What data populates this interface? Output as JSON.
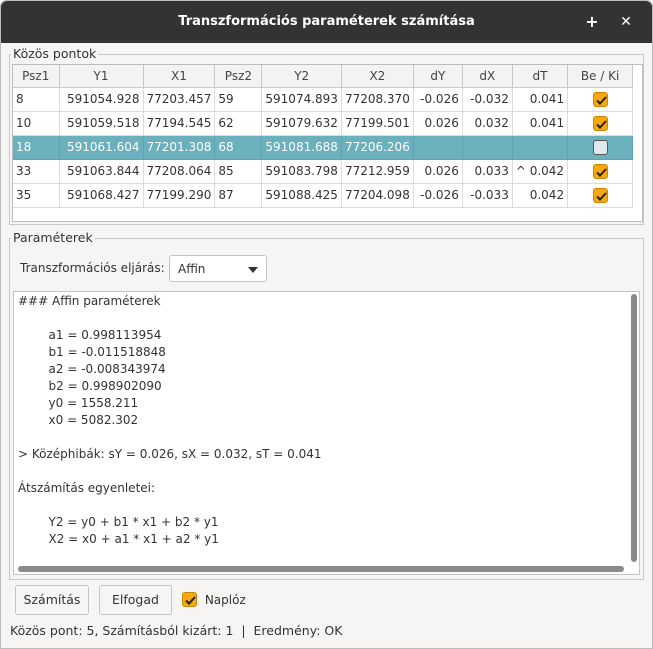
{
  "window": {
    "title": "Transzformációs paraméterek számítása",
    "plus_glyph": "+",
    "close_glyph": "✕"
  },
  "common_points": {
    "label": "Közös pontok",
    "columns": [
      "Psz1",
      "Y1",
      "X1",
      "Psz2",
      "Y2",
      "X2",
      "dY",
      "dX",
      "dT",
      "Be / Ki"
    ],
    "rows": [
      {
        "psz1": "8",
        "y1": "591054.928",
        "x1": "77203.457",
        "psz2": "59",
        "y2": "591074.893",
        "x2": "77208.370",
        "dy": "-0.026",
        "dx": "-0.032",
        "dt": "0.041",
        "enabled": true,
        "selected": false
      },
      {
        "psz1": "10",
        "y1": "591059.518",
        "x1": "77194.545",
        "psz2": "62",
        "y2": "591079.632",
        "x2": "77199.501",
        "dy": "0.026",
        "dx": "0.032",
        "dt": "0.041",
        "enabled": true,
        "selected": false
      },
      {
        "psz1": "18",
        "y1": "591061.604",
        "x1": "77201.308",
        "psz2": "68",
        "y2": "591081.688",
        "x2": "77206.206",
        "dy": "",
        "dx": "",
        "dt": "",
        "enabled": false,
        "selected": true
      },
      {
        "psz1": "33",
        "y1": "591063.844",
        "x1": "77208.064",
        "psz2": "85",
        "y2": "591083.798",
        "x2": "77212.959",
        "dy": "0.026",
        "dx": "0.033",
        "dt": "^ 0.042",
        "enabled": true,
        "selected": false
      },
      {
        "psz1": "35",
        "y1": "591068.427",
        "x1": "77199.290",
        "psz2": "87",
        "y2": "591088.425",
        "x2": "77204.098",
        "dy": "-0.026",
        "dx": "-0.033",
        "dt": "0.042",
        "enabled": true,
        "selected": false
      }
    ]
  },
  "parameters": {
    "label": "Paraméterek",
    "method_label": "Transzformációs eljárás:",
    "method_value": "Affin",
    "log_lines": [
      "### Affin paraméterek",
      "",
      "        a1 = 0.998113954",
      "        b1 = -0.011518848",
      "        a2 = -0.008343974",
      "        b2 = 0.998902090",
      "        y0 = 1558.211",
      "        x0 = 5082.302",
      "",
      "> Középhibák: sY = 0.026, sX = 0.032, sT = 0.041",
      "",
      "Átszámítás egyenletei:",
      "",
      "        Y2 = y0 + b1 * x1 + b2 * y1",
      "        X2 = x0 + a1 * x1 + a2 * y1"
    ]
  },
  "actions": {
    "compute_label": "Számítás",
    "accept_label": "Elfogad",
    "log_label": "Naplóz",
    "log_checked": true
  },
  "status": {
    "text": "Közös pont: 5, Számításból kizárt: 1  |  Eredmény: OK"
  },
  "colors": {
    "accent": "#f5a80f",
    "selection": "#6ab0bd",
    "titlebar": "#333333"
  }
}
